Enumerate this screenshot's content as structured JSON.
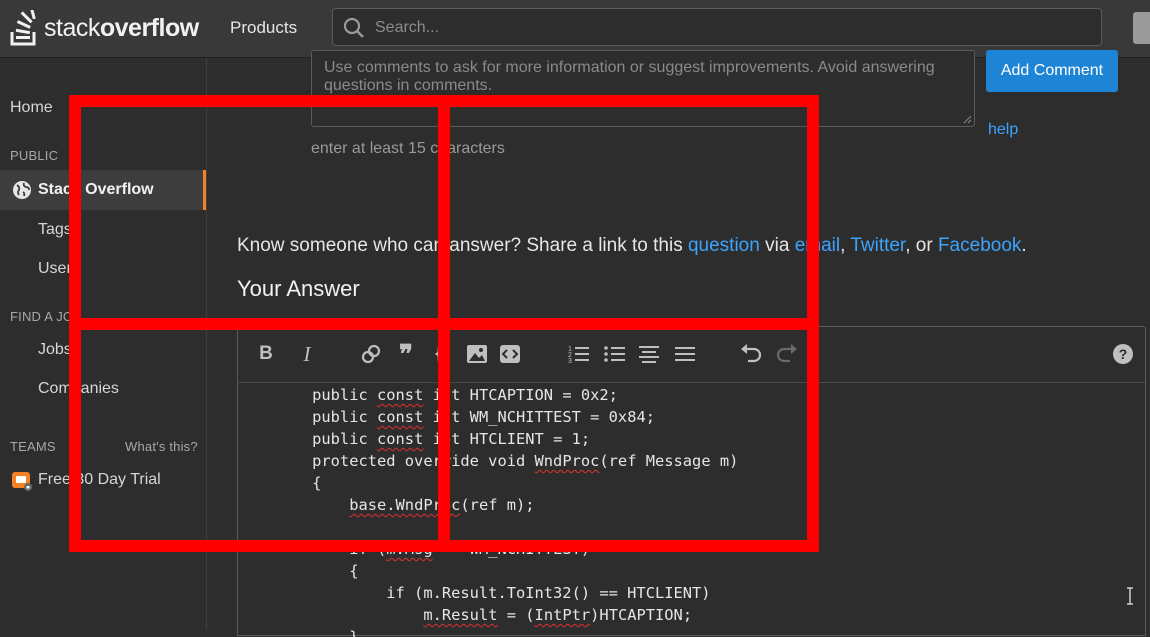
{
  "header": {
    "logo_text_light": "stack",
    "logo_text_bold": "overflow",
    "products_label": "Products",
    "search_placeholder": "Search..."
  },
  "sidebar": {
    "home": "Home",
    "public_label": "PUBLIC",
    "stack_overflow": "Stack Overflow",
    "tags": "Tags",
    "users": "Users",
    "find_a_job_label": "FIND A JOB",
    "jobs": "Jobs",
    "companies": "Companies",
    "teams_label": "TEAMS",
    "whats_this": "What's this?",
    "free_trial": "Free 30 Day Trial"
  },
  "comment": {
    "placeholder": "Use comments to ask for more information or suggest improvements. Avoid answering questions in comments.",
    "add_button": "Add Comment",
    "help": "help",
    "hint": "enter at least 15 characters"
  },
  "share": {
    "prefix": "Know someone who can answer? Share a link to this ",
    "question": "question",
    "via": " via ",
    "email": "email",
    "comma1": ", ",
    "twitter": "Twitter",
    "or": ", or ",
    "facebook": "Facebook",
    "period": "."
  },
  "answer": {
    "heading": "Your Answer"
  },
  "code": {
    "lines": [
      [
        "        public ",
        "const",
        " int HTCAPTION = 0x2;"
      ],
      [
        "        public ",
        "const",
        " int WM_NCHITTEST = 0x84;"
      ],
      [
        "        public ",
        "const",
        " int HTCLIENT = 1;"
      ],
      [
        "        protected override void ",
        "WndProc",
        "(ref Message m)"
      ],
      [
        "        {",
        "",
        ""
      ],
      [
        "            ",
        "base.WndProc",
        "(ref m);"
      ],
      [
        "",
        "",
        ""
      ],
      [
        "            if (",
        "m.Msg",
        " == WM_NCHITTEST)"
      ],
      [
        "            {",
        "",
        ""
      ],
      [
        "                if (m.Result.ToInt32() == HTCLIENT)",
        "",
        ""
      ],
      [
        "                    ",
        "m.Result",
        " = ("
      ],
      [
        "            }",
        "",
        ""
      ]
    ],
    "line10_tail_sq": "IntPtr",
    "line10_tail": ")HTCAPTION;"
  }
}
